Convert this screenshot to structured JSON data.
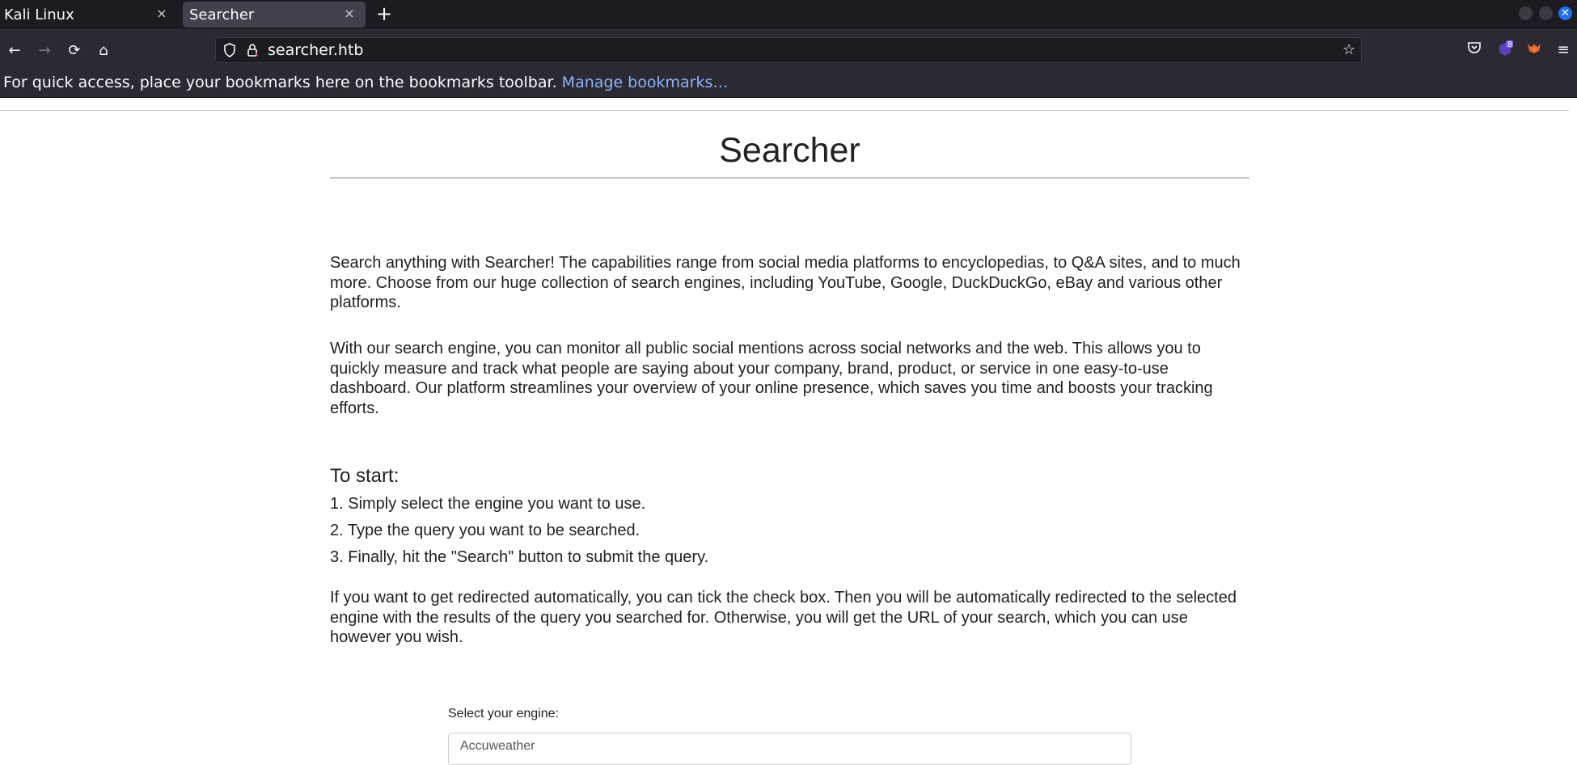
{
  "tabs": [
    {
      "label": "Kali Linux",
      "close": "×"
    },
    {
      "label": "Searcher",
      "close": "×"
    }
  ],
  "new_tab": "+",
  "nav": {
    "back": "←",
    "forward": "→",
    "reload": "⟳",
    "home": "⌂"
  },
  "url": "searcher.htb",
  "extensions": {
    "badge": "8"
  },
  "bookmarks_bar": {
    "text": "For quick access, place your bookmarks here on the bookmarks toolbar.",
    "link": "Manage bookmarks…"
  },
  "page": {
    "title": "Searcher",
    "intro_1": "Search anything with Searcher! The capabilities range from social media platforms to encyclopedias, to Q&A sites, and to much more. Choose from our huge collection of search engines, including YouTube, Google, DuckDuckGo, eBay and various other platforms.",
    "intro_2": "With our search engine, you can monitor all public social mentions across social networks and the web. This allows you to quickly measure and track what people are saying about your company, brand, product, or service in one easy-to-use dashboard. Our platform streamlines your overview of your online presence, which saves you time and boosts your tracking efforts.",
    "start_heading": "To start:",
    "steps": [
      "1. Simply select the engine you want to use.",
      "2. Type the query you want to be searched.",
      "3. Finally, hit the \"Search\" button to submit the query."
    ],
    "redirect_note": "If you want to get redirected automatically, you can tick the check box. Then you will be automatically redirected to the selected engine with the results of the query you searched for. Otherwise, you will get the URL of your search, which you can use however you wish.",
    "engine_label": "Select your engine:",
    "engine_value": "Accuweather"
  }
}
